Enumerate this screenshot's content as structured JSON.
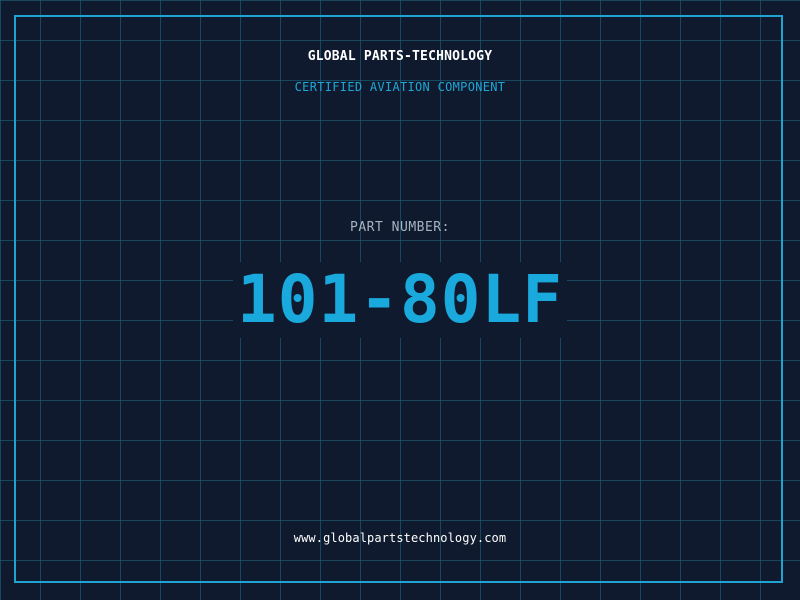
{
  "header": {
    "company": "GLOBAL PARTS-TECHNOLOGY",
    "tagline": "CERTIFIED AVIATION COMPONENT"
  },
  "part": {
    "label": "PART NUMBER:",
    "number": "101-80LF"
  },
  "footer": {
    "website": "www.globalpartstechnology.com"
  },
  "colors": {
    "background": "#0f1a2e",
    "grid": "#1e6e87",
    "frame": "#1fa3d0",
    "accent": "#1aa9dc",
    "label": "#a6b3c2",
    "text": "#ffffff"
  }
}
